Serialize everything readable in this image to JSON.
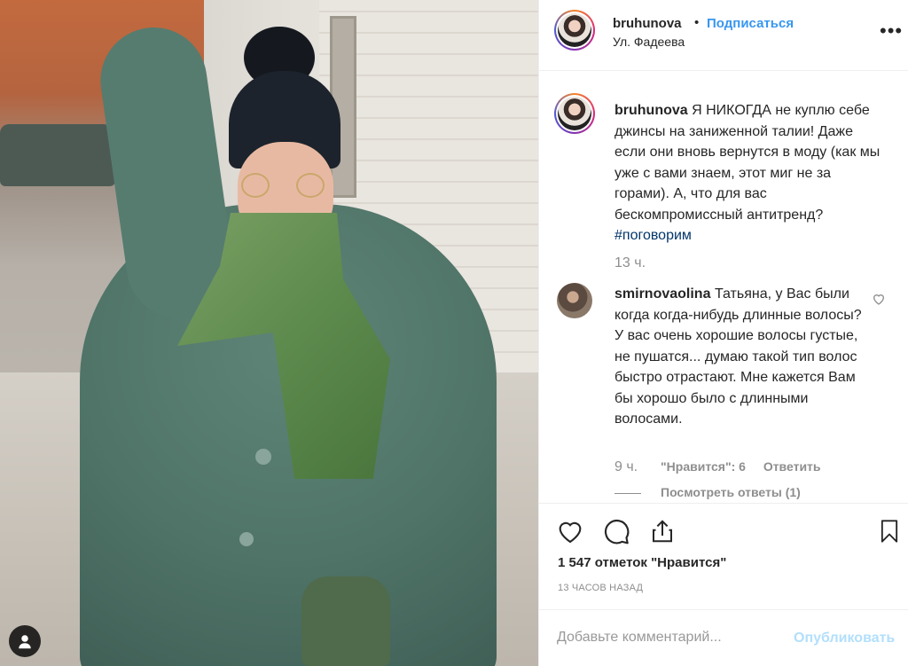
{
  "post": {
    "username": "bruhunova",
    "separator": "•",
    "follow_label": "Подписаться",
    "location": "Ул. Фадеева",
    "more_label": "•••"
  },
  "caption": {
    "username": "bruhunova",
    "text": "Я НИКОГДА не куплю себе джинсы на заниженной талии! Даже если они вновь вернутся в моду (как мы уже с вами знаем, этот миг не за горами). А, что для вас бескомпромиссный антитренд?",
    "hashtag": "#поговорим",
    "time": "13 ч."
  },
  "comment": {
    "username": "smirnovaolina",
    "text": "Татьяна, у Вас были когда когда-нибудь длинные волосы? У вас очень хорошие волосы густые, не пушатся... думаю такой тип волос быстро отрастают. Мне кажется Вам бы хорошо было с длинными волосами.",
    "time": "9 ч.",
    "likes": "\"Нравится\": 6",
    "reply_label": "Ответить",
    "view_replies": "Посмотреть ответы (1)"
  },
  "actions": {
    "likes_count": "1 547 отметок \"Нравится\"",
    "posted": "13 ЧАСОВ НАЗАД"
  },
  "add_comment": {
    "placeholder": "Добавьте комментарий...",
    "publish_label": "Опубликовать"
  },
  "icons": {
    "user_tag": "user-icon",
    "more": "more-icon",
    "heart": "heart-icon",
    "comment": "comment-icon",
    "share": "share-icon",
    "save": "bookmark-icon"
  },
  "colors": {
    "accent": "#3897f0",
    "publish_disabled": "#b2dffc",
    "muted": "#8e8e8e",
    "text": "#262626"
  }
}
